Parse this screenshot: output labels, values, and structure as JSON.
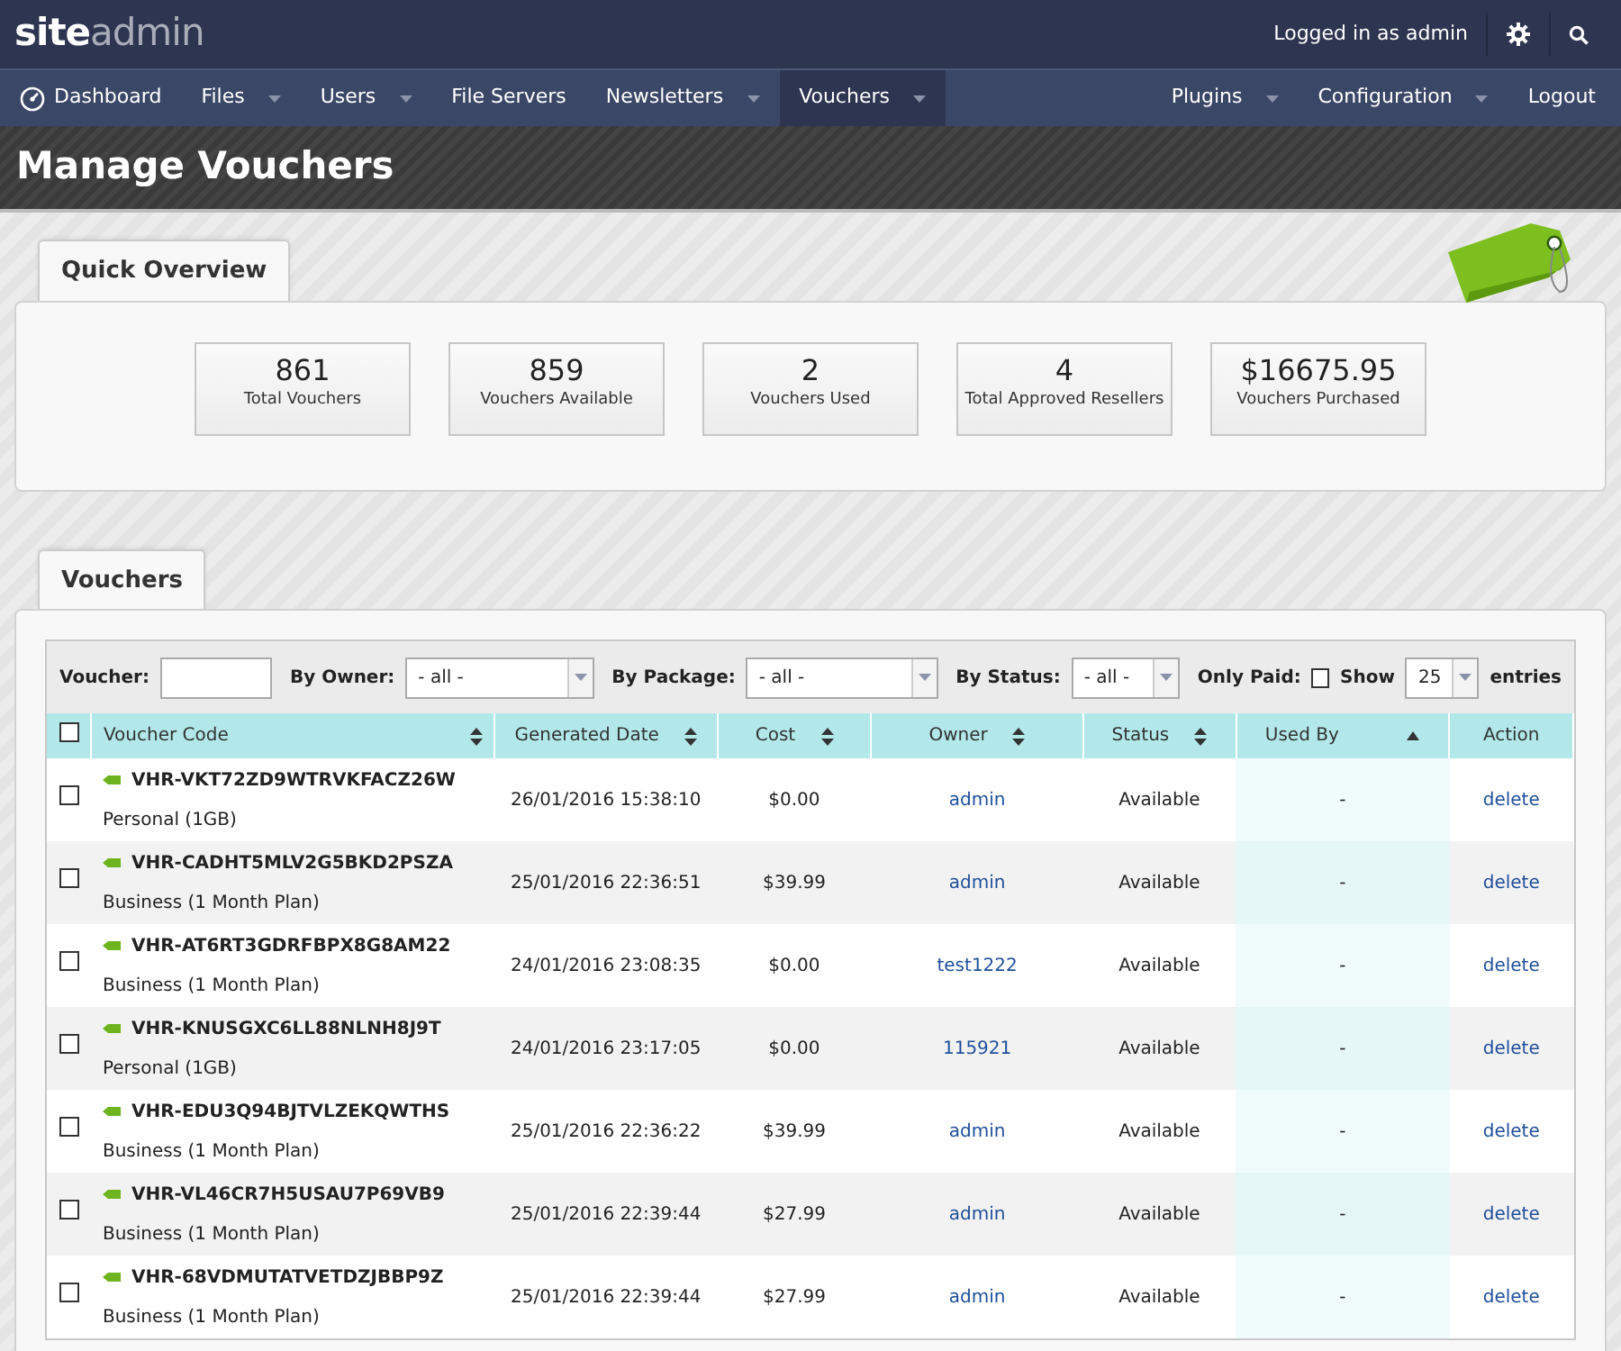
{
  "topbar": {
    "logo_bold": "site",
    "logo_light": "admin",
    "user_text": "Logged in as admin"
  },
  "nav": {
    "left": [
      {
        "label": "Dashboard",
        "kind": "icon",
        "caret": false,
        "selected": false
      },
      {
        "label": "Files",
        "caret": true,
        "selected": false
      },
      {
        "label": "Users",
        "caret": true,
        "selected": false
      },
      {
        "label": "File Servers",
        "caret": false,
        "selected": false
      },
      {
        "label": "Newsletters",
        "caret": true,
        "selected": false
      },
      {
        "label": "Vouchers",
        "caret": true,
        "selected": true
      }
    ],
    "right": [
      {
        "label": "Plugins",
        "caret": true,
        "selected": false
      },
      {
        "label": "Configuration",
        "caret": true,
        "selected": false
      },
      {
        "label": "Logout",
        "caret": false,
        "selected": false
      }
    ]
  },
  "page_title": "Manage Vouchers",
  "overview": {
    "tab": "Quick Overview",
    "stats": [
      {
        "value": "861",
        "label": "Total Vouchers"
      },
      {
        "value": "859",
        "label": "Vouchers Available"
      },
      {
        "value": "2",
        "label": "Vouchers Used"
      },
      {
        "value": "4",
        "label": "Total Approved Resellers"
      },
      {
        "value": "$16675.95",
        "label": "Vouchers Purchased"
      }
    ]
  },
  "vouchers": {
    "tab": "Vouchers",
    "filters": {
      "voucher_label": "Voucher:",
      "owner_label": "By Owner:",
      "owner_value": "- all -",
      "package_label": "By Package:",
      "package_value": "- all -",
      "status_label": "By Status:",
      "status_value": "- all -",
      "paid_label": "Only Paid:",
      "paid_checked": false,
      "show_label": "Show",
      "show_value": "25",
      "entries_label": "entries"
    },
    "select_all_checked": false,
    "columns": [
      {
        "label": "Voucher Code",
        "sortable": true,
        "sorted": false
      },
      {
        "label": "Generated Date",
        "sortable": true,
        "sorted": false
      },
      {
        "label": "Cost",
        "sortable": true,
        "sorted": false
      },
      {
        "label": "Owner",
        "sortable": true,
        "sorted": false
      },
      {
        "label": "Status",
        "sortable": true,
        "sorted": false
      },
      {
        "label": "Used By",
        "sortable": true,
        "sorted": true
      },
      {
        "label": "Action",
        "sortable": false
      }
    ],
    "rows": [
      {
        "checked": false,
        "code": "VHR-VKT72ZD9WTRVKFACZ26W",
        "package": "Personal (1GB)",
        "date": "26/01/2016 15:38:10",
        "cost": "$0.00",
        "owner": "admin",
        "status": "Available",
        "used_by": "-",
        "action": "delete"
      },
      {
        "checked": false,
        "code": "VHR-CADHT5MLV2G5BKD2PSZA",
        "package": "Business (1 Month Plan)",
        "date": "25/01/2016 22:36:51",
        "cost": "$39.99",
        "owner": "admin",
        "status": "Available",
        "used_by": "-",
        "action": "delete"
      },
      {
        "checked": false,
        "code": "VHR-AT6RT3GDRFBPX8G8AM22",
        "package": "Business (1 Month Plan)",
        "date": "24/01/2016 23:08:35",
        "cost": "$0.00",
        "owner": "test1222",
        "status": "Available",
        "used_by": "-",
        "action": "delete"
      },
      {
        "checked": false,
        "code": "VHR-KNUSGXC6LL88NLNH8J9T",
        "package": "Personal (1GB)",
        "date": "24/01/2016 23:17:05",
        "cost": "$0.00",
        "owner": "115921",
        "status": "Available",
        "used_by": "-",
        "action": "delete"
      },
      {
        "checked": false,
        "code": "VHR-EDU3Q94BJTVLZEKQWTHS",
        "package": "Business (1 Month Plan)",
        "date": "25/01/2016 22:36:22",
        "cost": "$39.99",
        "owner": "admin",
        "status": "Available",
        "used_by": "-",
        "action": "delete"
      },
      {
        "checked": false,
        "code": "VHR-VL46CR7H5USAU7P69VB9",
        "package": "Business (1 Month Plan)",
        "date": "25/01/2016 22:39:44",
        "cost": "$27.99",
        "owner": "admin",
        "status": "Available",
        "used_by": "-",
        "action": "delete"
      },
      {
        "checked": false,
        "code": "VHR-68VDMUTATVETDZJBBP9Z",
        "package": "Business (1 Month Plan)",
        "date": "25/01/2016 22:39:44",
        "cost": "$27.99",
        "owner": "admin",
        "status": "Available",
        "used_by": "-",
        "action": "delete"
      }
    ]
  }
}
